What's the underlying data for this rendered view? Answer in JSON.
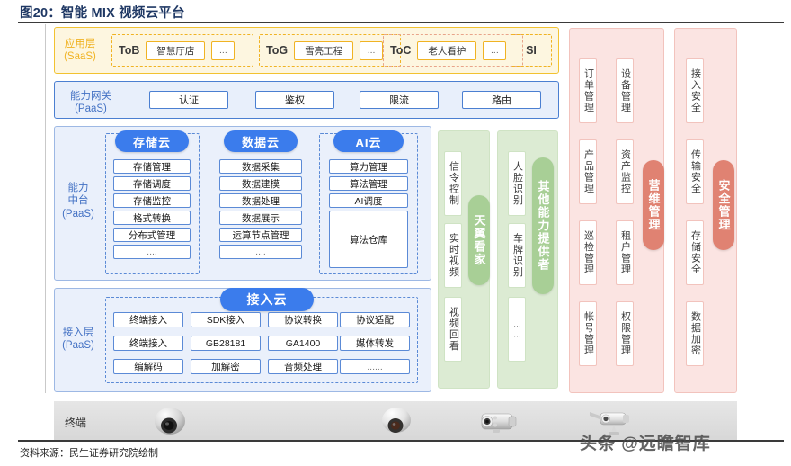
{
  "figure": {
    "title": "图20：智能 MIX 视频云平台",
    "source_note": "资料来源：民生证券研究院绘制",
    "watermark": "头条 @远瞻智库"
  },
  "app_layer": {
    "label": "应用层\n(SaaS)",
    "label_line1": "应用层",
    "label_line2": "(SaaS)",
    "groups": [
      {
        "tag": "ToB",
        "items": [
          "智慧厅店",
          "..."
        ]
      },
      {
        "tag": "ToG",
        "items": [
          "雪亮工程",
          "..."
        ]
      },
      {
        "tag": "ToC",
        "items": [
          "老人看护",
          "..."
        ]
      },
      {
        "tag": "SI",
        "items": []
      }
    ]
  },
  "gateway_layer": {
    "label_line1": "能力网关",
    "label_line2": "(PaaS)",
    "items": [
      "认证",
      "鉴权",
      "限流",
      "路由"
    ]
  },
  "capability_layer": {
    "label_line1": "能力",
    "label_line2": "中台",
    "label_line3": "(PaaS)",
    "clouds": [
      {
        "name": "存储云",
        "items": [
          "存储管理",
          "存储调度",
          "存储监控",
          "格式转换",
          "分布式管理",
          "...."
        ]
      },
      {
        "name": "数据云",
        "items": [
          "数据采集",
          "数据建模",
          "数据处理",
          "数据展示",
          "运算节点管理",
          "...."
        ]
      },
      {
        "name": "AI云",
        "items": [
          "算力管理",
          "算法管理",
          "AI调度",
          "算法仓库"
        ]
      }
    ]
  },
  "access_layer": {
    "label_line1": "接入层",
    "label_line2": "(PaaS)",
    "cloud_name": "接入云",
    "rows": [
      [
        "终端接入",
        "SDK接入",
        "协议转换",
        "协议适配"
      ],
      [
        "终端接入",
        "GB28181",
        "GA1400",
        "媒体转发"
      ],
      [
        "编解码",
        "加解密",
        "音频处理",
        "......"
      ]
    ]
  },
  "green_columns": [
    {
      "pill": "天翼看家",
      "items": [
        "信令控制",
        "实时视频",
        "视频回看"
      ]
    },
    {
      "pill": "其他能力提供者",
      "items": [
        "人脸识别",
        "车牌识别",
        "……"
      ]
    }
  ],
  "pink_columns": [
    {
      "pill": "营维管理",
      "col_a": [
        "订单管理",
        "产品管理",
        "巡检管理",
        "帐号管理"
      ],
      "col_b": [
        "设备管理",
        "资产监控",
        "租户管理",
        "权限管理"
      ]
    },
    {
      "pill": "安全管理",
      "col_a": [
        "接入安全",
        "传输安全",
        "存储安全",
        "数据加密"
      ],
      "col_b": []
    }
  ],
  "terminal_bar": {
    "label": "终端",
    "devices": [
      "dome-camera",
      "dome-camera",
      "bullet-camera",
      "bullet-camera"
    ]
  },
  "colors": {
    "title": "#1f3864",
    "yellow": "#f0b323",
    "blue": "#3b7cec",
    "blue_border": "#5b8ad6",
    "green": "#a8cf96",
    "green_bg": "#dcebd3",
    "pink": "#e08272",
    "pink_bg": "#fbe4e2"
  }
}
